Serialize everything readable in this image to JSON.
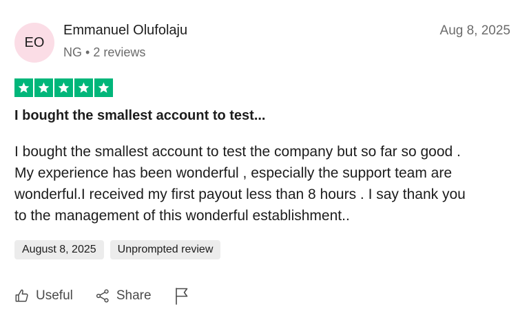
{
  "reviewer": {
    "initials": "EO",
    "name": "Emmanuel Olufolaju",
    "country": "NG",
    "reviews_count": "2 reviews",
    "avatar_color": "#fbdde6"
  },
  "review": {
    "date": "Aug 8, 2025",
    "rating": 5,
    "rating_max": 5,
    "star_color": "#00b67a",
    "title": "I bought the smallest account to test...",
    "body_lines": [
      "I bought the smallest account to test the company but so far so good .",
      "My experience has been wonderful , especially the support team are",
      "wonderful.I received my first payout less than 8 hours . I say thank you",
      "to the management of this wonderful establishment.."
    ]
  },
  "tags": {
    "experience_date": "August 8, 2025",
    "review_type": "Unprompted review"
  },
  "actions": {
    "useful_label": "Useful",
    "share_label": "Share",
    "useful_icon": "thumbs-up-icon",
    "share_icon": "share-icon",
    "report_icon": "flag-icon"
  }
}
